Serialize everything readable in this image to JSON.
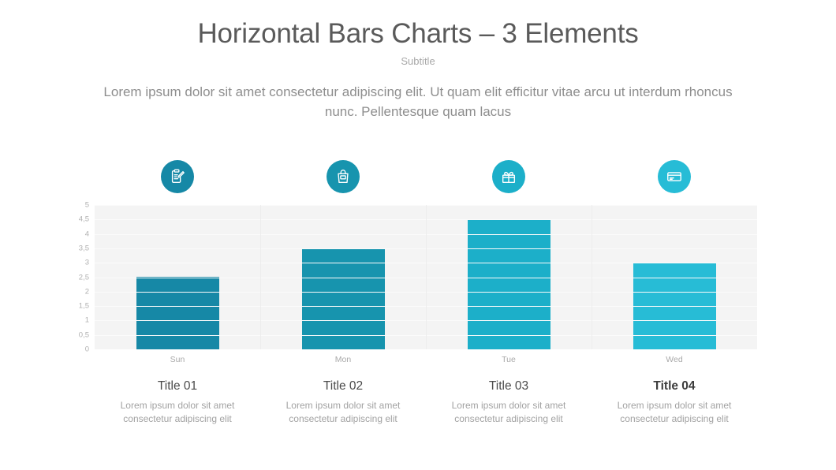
{
  "header": {
    "title": "Horizontal Bars Charts – 3 Elements",
    "subtitle": "Subtitle",
    "body": "Lorem ipsum dolor sit amet consectetur adipiscing elit. Ut quam elit efficitur vitae arcu ut interdum rhoncus nunc. Pellentesque quam lacus"
  },
  "colors": {
    "bar1": "#1688a6",
    "bar2": "#1794ae",
    "bar3": "#1cafc9",
    "bar4": "#27bcd6",
    "plot_bg": "#f4f4f4",
    "gridline": "#fbfbfb",
    "text_dark": "#4a4a4a",
    "text_muted": "#a2a2a2"
  },
  "icons": [
    {
      "name": "clipboard-pencil-icon",
      "color": "#1688a6"
    },
    {
      "name": "shopping-bag-icon",
      "color": "#1794ae"
    },
    {
      "name": "gift-box-icon",
      "color": "#1cafc9"
    },
    {
      "name": "credit-card-icon",
      "color": "#27bcd6"
    }
  ],
  "chart_data": {
    "type": "bar",
    "title": "",
    "xlabel": "",
    "ylabel": "",
    "categories": [
      "Sun",
      "Mon",
      "Tue",
      "Wed"
    ],
    "values": [
      2.5,
      3.5,
      4.5,
      3
    ],
    "colors": [
      "#1688a6",
      "#1794ae",
      "#1cafc9",
      "#27bcd6"
    ],
    "ylim": [
      0,
      5
    ],
    "ytick_labels": [
      "5",
      "4,5",
      "4",
      "3,5",
      "3",
      "2,5",
      "2",
      "1,5",
      "1",
      "0,5",
      "0"
    ],
    "ytick_values": [
      5,
      4.5,
      4,
      3.5,
      3,
      2.5,
      2,
      1.5,
      1,
      0.5,
      0
    ],
    "grid": true,
    "legend": false
  },
  "captions": [
    {
      "title": "Title 01",
      "desc": "Lorem ipsum dolor sit amet consectetur adipiscing elit",
      "bold": false
    },
    {
      "title": "Title 02",
      "desc": "Lorem ipsum dolor sit amet consectetur adipiscing elit",
      "bold": false
    },
    {
      "title": "Title 03",
      "desc": "Lorem ipsum dolor sit amet consectetur adipiscing elit",
      "bold": false
    },
    {
      "title": "Title 04",
      "desc": "Lorem ipsum dolor sit amet consectetur adipiscing elit",
      "bold": true
    }
  ]
}
